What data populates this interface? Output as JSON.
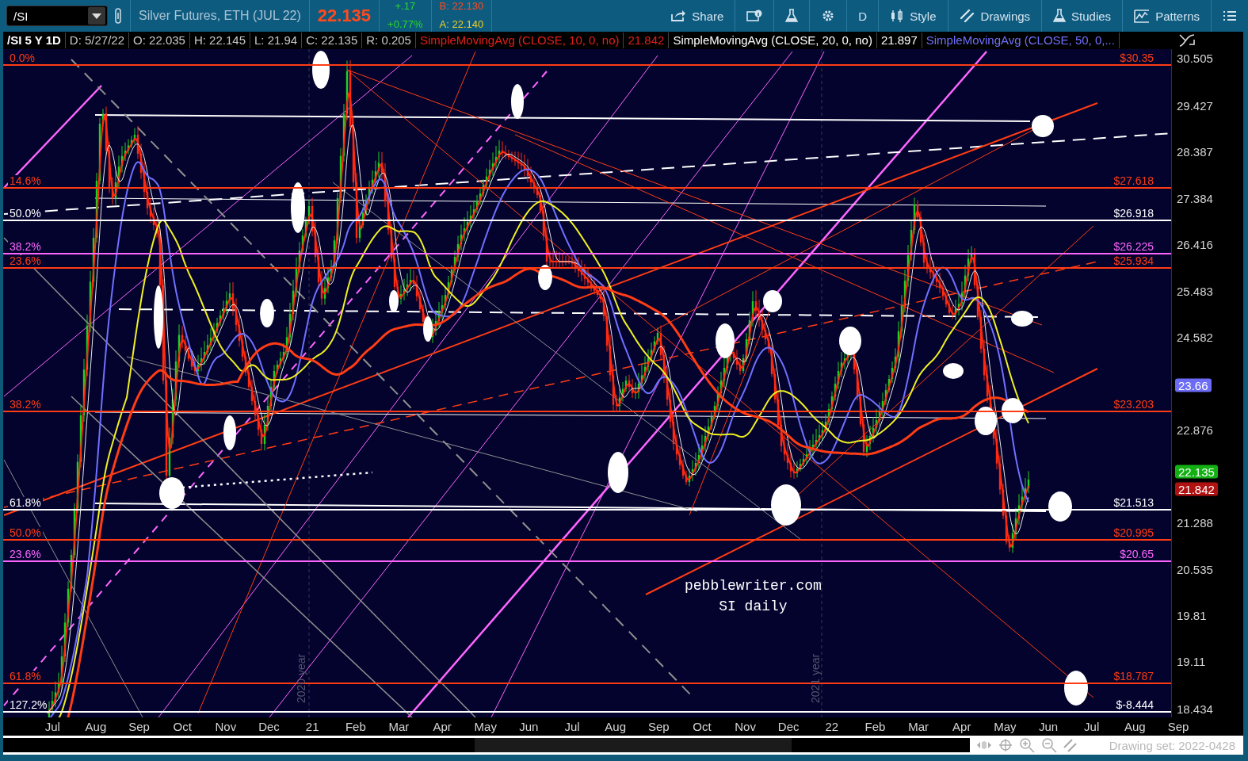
{
  "toolbar": {
    "symbol": "/SI",
    "instrument": "Silver Futures, ETH (JUL 22)",
    "last_price": "22.135",
    "change": "+.17",
    "change_percent": "+0.77%",
    "bid": "B: 22.130",
    "ask": "A: 22.140",
    "buttons": [
      {
        "kind": "share",
        "label": "Share"
      },
      {
        "kind": "info"
      },
      {
        "kind": "flask"
      },
      {
        "kind": "gear"
      },
      {
        "kind": "text",
        "label": "D"
      },
      {
        "kind": "style",
        "label": "Style"
      },
      {
        "kind": "drawings",
        "label": "Drawings"
      },
      {
        "kind": "studies",
        "label": "Studies"
      },
      {
        "kind": "patterns",
        "label": "Patterns"
      },
      {
        "kind": "menu"
      }
    ]
  },
  "header": {
    "title": "/SI 5 Y 1D",
    "fields": [
      "D: 5/27/22",
      "O: 22.035",
      "H: 22.145",
      "L: 21.94",
      "C: 22.135",
      "R: 0.205"
    ],
    "studies": [
      {
        "label": "SimpleMovingAvg (CLOSE, 10, 0, no)",
        "value": "21.842",
        "kind": "red"
      },
      {
        "label": "SimpleMovingAvg (CLOSE, 20, 0, no)",
        "value": "21.897",
        "kind": "white"
      },
      {
        "label": "SimpleMovingAvg (CLOSE, 50, 0,...",
        "kind": "blue"
      }
    ]
  },
  "chart": {
    "levels": [
      {
        "left_label": "0.0%",
        "right_label": "$30.35",
        "color": "#ff3c14"
      },
      {
        "left_label": "14.6%",
        "right_label": "$27.618",
        "color": "#ff3c14"
      },
      {
        "left_label": "50.0%",
        "right_label": "$26.918",
        "color": "#ffffff"
      },
      {
        "left_label": "38.2%",
        "right_label": "$26.225",
        "color": "#ff66ff"
      },
      {
        "left_label": "23.6%",
        "right_label": "$25.934",
        "color": "#ff3c14"
      },
      {
        "left_label": "38.2%",
        "right_label": "$23.203",
        "color": "#ff3c14"
      },
      {
        "left_label": "61.8%",
        "right_label": "$21.513",
        "color": "#ffffff"
      },
      {
        "left_label": "50.0%",
        "right_label": "$20.995",
        "color": "#ff3c14"
      },
      {
        "left_label": "23.6%",
        "right_label": "$20.65",
        "color": "#ff66ff"
      },
      {
        "left_label": "61.8%",
        "right_label": "$18.787",
        "color": "#ff3c14"
      },
      {
        "left_label": "127.2%",
        "right_label": "$-8.444",
        "color": "#ffffff"
      }
    ],
    "notes": [
      "pebblewriter.com",
      "SI daily"
    ],
    "year_markers": [
      "2020 year",
      "2021 year"
    ]
  },
  "price_axis": {
    "ticks": [
      "30.505",
      "29.427",
      "28.387",
      "27.384",
      "26.416",
      "25.483",
      "24.582",
      "22.876",
      "21.288",
      "20.535",
      "19.81",
      "19.11",
      "18.434"
    ],
    "badges": [
      {
        "text": "23.66",
        "color": "#6b6bf5"
      },
      {
        "text": "22.135",
        "color": "#12b012"
      },
      {
        "text": "21.842",
        "color": "#b01212"
      }
    ]
  },
  "time_axis": {
    "labels": [
      "Jul",
      "Aug",
      "Sep",
      "Oct",
      "Nov",
      "Dec",
      "21",
      "Feb",
      "Mar",
      "Apr",
      "May",
      "Jun",
      "Jul",
      "Aug",
      "Sep",
      "Oct",
      "Nov",
      "Dec",
      "22",
      "Feb",
      "Mar",
      "Apr",
      "May",
      "Jun",
      "Jul",
      "Aug",
      "Sep"
    ]
  },
  "footer": {
    "drawing_set": "Drawing set: 2022-0428"
  }
}
